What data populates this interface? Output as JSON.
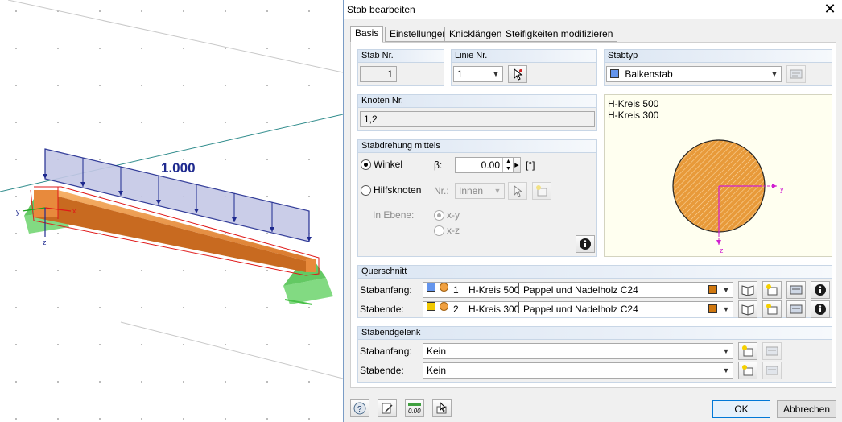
{
  "viewport": {
    "load_label": "1.000",
    "axis_y": "y",
    "axis_x": "x",
    "axis_z": "z"
  },
  "dialog": {
    "title": "Stab bearbeiten",
    "close_glyph": "✕",
    "tabs": [
      {
        "label": "Basis"
      },
      {
        "label": "Einstellungen"
      },
      {
        "label": "Knicklängen"
      },
      {
        "label": "Steifigkeiten modifizieren"
      }
    ],
    "stab_nr": {
      "header": "Stab Nr.",
      "value": "1"
    },
    "linie_nr": {
      "header": "Linie Nr.",
      "value": "1"
    },
    "stabtyp": {
      "header": "Stabtyp",
      "value": "Balkenstab",
      "color": "#6495ed"
    },
    "knoten": {
      "header": "Knoten Nr.",
      "value": "1,2"
    },
    "stabdrehung": {
      "header": "Stabdrehung mittels",
      "winkel_label": "Winkel",
      "beta_label": "β:",
      "beta_value": "0.00",
      "unit": "[°]",
      "hilfsknoten_label": "Hilfsknoten",
      "nr_label": "Nr.:",
      "nr_value": "Innen",
      "in_ebene_label": "In Ebene:",
      "xy_label": "x-y",
      "xz_label": "x-z"
    },
    "preview": {
      "line1": "H-Kreis 500",
      "line2": "H-Kreis 300",
      "axis_y": "y",
      "axis_z": "z"
    },
    "querschnitt": {
      "header": "Querschnitt",
      "rows": [
        {
          "label": "Stabanfang:",
          "color": "#6495ed",
          "nr": "1",
          "name": "H-Kreis 500",
          "material": "Pappel und Nadelholz C24"
        },
        {
          "label": "Stabende:",
          "color": "#f0c800",
          "nr": "2",
          "name": "H-Kreis 300",
          "material": "Pappel und Nadelholz C24"
        }
      ]
    },
    "stabendgelenk": {
      "header": "Stabendgelenk",
      "rows": [
        {
          "label": "Stabanfang:",
          "value": "Kein"
        },
        {
          "label": "Stabende:",
          "value": "Kein"
        }
      ]
    },
    "footer": {
      "ok_label": "OK",
      "cancel_label": "Abbrechen",
      "units_value": "0.00"
    }
  }
}
